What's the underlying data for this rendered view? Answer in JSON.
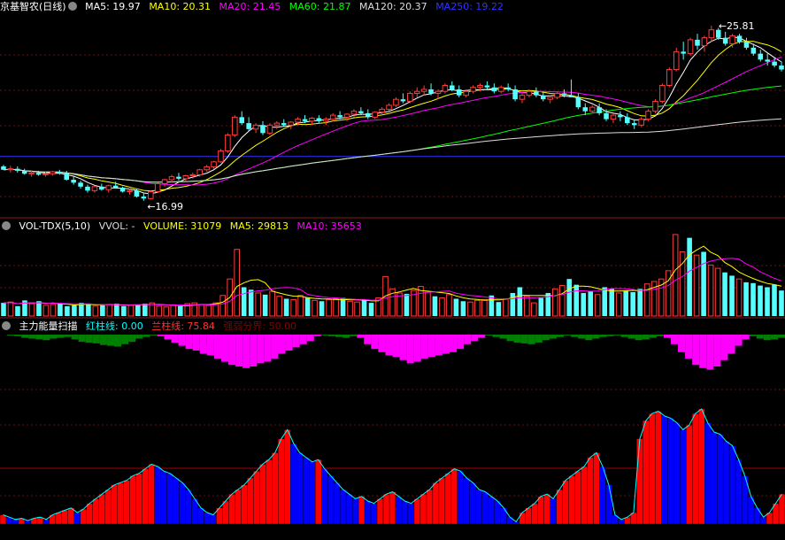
{
  "stock": {
    "name": "京基智农(日线)",
    "ma": [
      {
        "label": "MA5: 19.97",
        "color": "#ffffff"
      },
      {
        "label": "MA10: 20.31",
        "color": "#ffff00"
      },
      {
        "label": "MA20: 21.45",
        "color": "#ff00ff"
      },
      {
        "label": "MA60: 21.87",
        "color": "#00ff00"
      },
      {
        "label": "MA120: 20.37",
        "color": "#dddddd"
      },
      {
        "label": "MA250: 19.22",
        "color": "#3333ff"
      }
    ]
  },
  "volume_panel": {
    "title": "VOL-TDX(5,10)",
    "items": [
      {
        "label": "VVOL: -",
        "color": "#dddddd"
      },
      {
        "label": "VOLUME: 31079",
        "color": "#ffff00"
      },
      {
        "label": "MA5: 29813",
        "color": "#ffff00"
      },
      {
        "label": "MA10: 35653",
        "color": "#ff00ff"
      }
    ]
  },
  "indicator_panel": {
    "title": "主力能量扫描",
    "items": [
      {
        "label": "红柱线: 0.00",
        "color": "#00ffff"
      },
      {
        "label": "兰柱线: 75.84",
        "color": "#ff3333"
      },
      {
        "label": "强弱分界: 50.00",
        "color": "#880000"
      }
    ]
  },
  "chart_data": [
    {
      "type": "candlestick",
      "title": "京基智农(日线)",
      "annotations": [
        {
          "label": "25.81",
          "type": "high"
        },
        {
          "label": "16.99",
          "type": "low"
        }
      ],
      "reference_lines": [
        {
          "name": "MA250",
          "value": 19.22,
          "color": "#3333ff"
        }
      ],
      "ylim": [
        16.4,
        26.3
      ],
      "colors": {
        "up": "#ff3c3c",
        "down": "#54ffff"
      },
      "candles_ohlc": [
        [
          18.72,
          18.8,
          18.55,
          18.55
        ],
        [
          18.55,
          18.75,
          18.42,
          18.6
        ],
        [
          18.6,
          18.72,
          18.4,
          18.5
        ],
        [
          18.5,
          18.6,
          18.3,
          18.35
        ],
        [
          18.35,
          18.5,
          18.2,
          18.4
        ],
        [
          18.4,
          18.5,
          18.25,
          18.3
        ],
        [
          18.3,
          18.45,
          18.2,
          18.35
        ],
        [
          18.35,
          18.5,
          18.25,
          18.45
        ],
        [
          18.45,
          18.55,
          18.3,
          18.4
        ],
        [
          18.4,
          18.5,
          18.0,
          18.05
        ],
        [
          18.05,
          18.2,
          17.8,
          17.9
        ],
        [
          17.9,
          18.0,
          17.6,
          17.7
        ],
        [
          17.7,
          17.8,
          17.4,
          17.5
        ],
        [
          17.5,
          17.75,
          17.4,
          17.7
        ],
        [
          17.7,
          17.85,
          17.5,
          17.55
        ],
        [
          17.55,
          17.8,
          17.4,
          17.75
        ],
        [
          17.75,
          17.95,
          17.6,
          17.65
        ],
        [
          17.65,
          17.7,
          17.4,
          17.45
        ],
        [
          17.45,
          17.6,
          17.3,
          17.5
        ],
        [
          17.5,
          17.6,
          17.15,
          17.2
        ],
        [
          17.2,
          17.35,
          16.99,
          17.1
        ],
        [
          17.1,
          17.5,
          17.05,
          17.45
        ],
        [
          17.45,
          17.9,
          17.4,
          17.85
        ],
        [
          17.85,
          18.1,
          17.7,
          18.05
        ],
        [
          18.05,
          18.3,
          17.9,
          18.2
        ],
        [
          18.2,
          18.4,
          18.0,
          18.1
        ],
        [
          18.1,
          18.3,
          17.95,
          18.25
        ],
        [
          18.25,
          18.4,
          18.1,
          18.3
        ],
        [
          18.3,
          18.6,
          18.2,
          18.55
        ],
        [
          18.55,
          18.8,
          18.45,
          18.7
        ],
        [
          18.7,
          19.0,
          18.6,
          18.95
        ],
        [
          18.95,
          19.6,
          18.9,
          19.5
        ],
        [
          19.5,
          20.4,
          19.4,
          20.3
        ],
        [
          20.3,
          21.3,
          20.2,
          21.2
        ],
        [
          21.2,
          21.5,
          20.8,
          20.9
        ],
        [
          20.9,
          21.2,
          20.5,
          20.6
        ],
        [
          20.6,
          20.9,
          20.4,
          20.8
        ],
        [
          20.8,
          21.0,
          20.3,
          20.4
        ],
        [
          20.4,
          20.9,
          20.3,
          20.8
        ],
        [
          20.8,
          21.0,
          20.6,
          20.9
        ],
        [
          20.9,
          21.1,
          20.7,
          20.8
        ],
        [
          20.8,
          21.0,
          20.6,
          20.95
        ],
        [
          20.95,
          21.2,
          20.8,
          21.1
        ],
        [
          21.1,
          21.3,
          20.9,
          21.0
        ],
        [
          21.0,
          21.2,
          20.8,
          21.15
        ],
        [
          21.15,
          21.3,
          20.9,
          21.0
        ],
        [
          21.0,
          21.2,
          20.8,
          21.1
        ],
        [
          21.1,
          21.4,
          21.0,
          21.3
        ],
        [
          21.3,
          21.5,
          21.1,
          21.2
        ],
        [
          21.2,
          21.4,
          21.0,
          21.35
        ],
        [
          21.35,
          21.6,
          21.2,
          21.5
        ],
        [
          21.5,
          21.7,
          21.3,
          21.4
        ],
        [
          21.4,
          21.6,
          21.1,
          21.2
        ],
        [
          21.2,
          21.5,
          21.1,
          21.45
        ],
        [
          21.45,
          21.7,
          21.3,
          21.6
        ],
        [
          21.6,
          21.9,
          21.5,
          21.8
        ],
        [
          21.8,
          22.2,
          21.7,
          22.1
        ],
        [
          22.1,
          22.4,
          21.9,
          22.0
        ],
        [
          22.0,
          22.5,
          21.9,
          22.4
        ],
        [
          22.4,
          22.7,
          22.2,
          22.5
        ],
        [
          22.5,
          22.8,
          22.3,
          22.6
        ],
        [
          22.6,
          22.9,
          22.3,
          22.4
        ],
        [
          22.4,
          22.6,
          22.1,
          22.5
        ],
        [
          22.5,
          22.9,
          22.4,
          22.8
        ],
        [
          22.8,
          23.0,
          22.5,
          22.6
        ],
        [
          22.6,
          22.8,
          22.2,
          22.3
        ],
        [
          22.3,
          22.6,
          22.2,
          22.5
        ],
        [
          22.5,
          22.8,
          22.4,
          22.7
        ],
        [
          22.7,
          22.9,
          22.5,
          22.8
        ],
        [
          22.8,
          23.0,
          22.6,
          22.7
        ],
        [
          22.7,
          22.9,
          22.4,
          22.5
        ],
        [
          22.5,
          22.8,
          22.4,
          22.7
        ],
        [
          22.7,
          22.9,
          22.5,
          22.6
        ],
        [
          22.6,
          22.8,
          22.0,
          22.1
        ],
        [
          22.1,
          22.4,
          21.9,
          22.3
        ],
        [
          22.3,
          22.6,
          22.2,
          22.5
        ],
        [
          22.5,
          22.7,
          22.2,
          22.3
        ],
        [
          22.3,
          22.5,
          22.0,
          22.1
        ],
        [
          22.1,
          22.3,
          21.9,
          22.2
        ],
        [
          22.2,
          22.5,
          22.1,
          22.4
        ],
        [
          22.4,
          22.6,
          22.2,
          22.3
        ],
        [
          22.3,
          23.1,
          22.2,
          22.2
        ],
        [
          22.2,
          22.4,
          21.6,
          21.7
        ],
        [
          21.7,
          21.9,
          21.3,
          21.5
        ],
        [
          21.5,
          21.8,
          21.4,
          21.7
        ],
        [
          21.7,
          21.9,
          21.3,
          21.4
        ],
        [
          21.4,
          21.6,
          21.0,
          21.1
        ],
        [
          21.1,
          21.4,
          20.9,
          21.3
        ],
        [
          21.3,
          21.5,
          21.0,
          21.2
        ],
        [
          21.2,
          21.4,
          20.8,
          20.9
        ],
        [
          20.9,
          21.1,
          20.6,
          20.8
        ],
        [
          20.8,
          21.2,
          20.7,
          21.1
        ],
        [
          21.1,
          21.6,
          21.0,
          21.5
        ],
        [
          21.5,
          22.1,
          21.4,
          22.0
        ],
        [
          22.0,
          22.9,
          21.9,
          22.8
        ],
        [
          22.8,
          23.7,
          22.7,
          23.6
        ],
        [
          23.6,
          24.7,
          23.5,
          24.5
        ],
        [
          24.5,
          25.0,
          24.1,
          24.4
        ],
        [
          24.4,
          25.2,
          24.3,
          25.1
        ],
        [
          25.1,
          25.4,
          24.6,
          24.8
        ],
        [
          24.8,
          25.3,
          24.5,
          25.2
        ],
        [
          25.2,
          25.81,
          25.0,
          25.6
        ],
        [
          25.6,
          25.7,
          25.1,
          25.2
        ],
        [
          25.2,
          25.5,
          24.8,
          24.9
        ],
        [
          24.9,
          25.4,
          24.7,
          25.3
        ],
        [
          25.3,
          25.4,
          24.9,
          25.0
        ],
        [
          25.0,
          25.2,
          24.6,
          24.7
        ],
        [
          24.7,
          24.9,
          24.3,
          24.4
        ],
        [
          24.4,
          24.6,
          24.0,
          24.1
        ],
        [
          24.1,
          24.4,
          23.8,
          24.0
        ],
        [
          24.0,
          24.2,
          23.7,
          23.8
        ],
        [
          23.8,
          24.0,
          23.5,
          23.6
        ]
      ]
    },
    {
      "type": "bar",
      "title": "VOL-TDX(5,10)",
      "series_name": "VOLUME",
      "ylim": [
        0,
        100000
      ],
      "colors": {
        "up": "#ff3c3c",
        "down": "#54ffff",
        "ma5": "#ffff00",
        "ma10": "#ff00ff"
      },
      "values": [
        16000,
        17000,
        12000,
        19000,
        15000,
        18000,
        13000,
        14000,
        15000,
        12000,
        13000,
        16000,
        15000,
        12000,
        13000,
        14000,
        15000,
        12000,
        13000,
        14000,
        15000,
        16000,
        12000,
        11000,
        13000,
        12000,
        15000,
        16000,
        14000,
        13000,
        16000,
        25000,
        45000,
        81000,
        35000,
        32000,
        28000,
        26000,
        30000,
        24000,
        21000,
        20000,
        25000,
        22000,
        19000,
        18000,
        20000,
        21000,
        22000,
        18000,
        17000,
        19000,
        16000,
        22000,
        48000,
        33000,
        28000,
        27000,
        31000,
        36000,
        29000,
        24000,
        22000,
        26000,
        21000,
        18000,
        17000,
        19000,
        20000,
        25000,
        17000,
        21000,
        28000,
        35000,
        24000,
        16000,
        22000,
        28000,
        33000,
        37000,
        45000,
        38000,
        28000,
        30000,
        26000,
        35000,
        33000,
        28000,
        31000,
        29000,
        33000,
        39000,
        42000,
        45000,
        55000,
        99000,
        78000,
        95000,
        74000,
        78000,
        62000,
        58000,
        53000,
        49000,
        45000,
        41000,
        40000,
        37000,
        35000,
        38000,
        31000
      ],
      "up_flags": [
        0,
        1,
        0,
        0,
        1,
        0,
        1,
        1,
        0,
        0,
        0,
        0,
        0,
        1,
        0,
        1,
        0,
        0,
        1,
        0,
        0,
        1,
        1,
        1,
        1,
        0,
        1,
        1,
        1,
        1,
        1,
        1,
        1,
        1,
        0,
        0,
        1,
        0,
        1,
        1,
        0,
        1,
        1,
        0,
        1,
        0,
        1,
        1,
        0,
        1,
        1,
        0,
        0,
        1,
        1,
        1,
        1,
        0,
        1,
        1,
        1,
        0,
        1,
        1,
        0,
        0,
        1,
        1,
        1,
        0,
        0,
        1,
        0,
        0,
        1,
        1,
        0,
        0,
        1,
        1,
        0,
        0,
        0,
        0,
        1,
        0,
        0,
        1,
        0,
        0,
        0,
        1,
        1,
        1,
        1,
        1,
        1,
        0,
        1,
        0,
        1,
        1,
        0,
        0,
        1,
        0,
        0,
        0,
        0,
        0,
        0
      ]
    },
    {
      "type": "bar",
      "title": "主力能量扫描",
      "series": [
        {
          "name": "红柱线",
          "color": "#ff0000"
        },
        {
          "name": "兰柱线",
          "color": "#0000ff"
        }
      ],
      "top_bars": {
        "colors": {
          "positive": "#ff00ff",
          "negative": "#008000"
        }
      },
      "reference_line": {
        "name": "强弱分界",
        "value": 50
      },
      "ylim": [
        0,
        100
      ],
      "values": [
        8,
        6,
        4,
        5,
        3,
        5,
        6,
        4,
        8,
        10,
        12,
        14,
        10,
        13,
        18,
        22,
        26,
        30,
        34,
        36,
        38,
        42,
        44,
        48,
        52,
        50,
        46,
        44,
        40,
        36,
        30,
        22,
        14,
        10,
        8,
        14,
        20,
        26,
        30,
        34,
        40,
        46,
        52,
        56,
        62,
        74,
        82,
        70,
        62,
        58,
        54,
        56,
        48,
        42,
        36,
        30,
        26,
        22,
        24,
        20,
        18,
        22,
        26,
        28,
        24,
        20,
        18,
        22,
        26,
        30,
        36,
        40,
        44,
        48,
        46,
        40,
        36,
        30,
        28,
        24,
        20,
        14,
        6,
        2,
        10,
        14,
        18,
        24,
        26,
        22,
        30,
        38,
        42,
        46,
        50,
        58,
        62,
        50,
        34,
        8,
        4,
        6,
        10,
        74,
        90,
        96,
        98,
        94,
        92,
        88,
        82,
        86,
        96,
        100,
        88,
        80,
        78,
        72,
        68,
        56,
        42,
        24,
        14,
        6,
        10,
        18,
        26
      ],
      "top_values": [
        0,
        -2,
        -4,
        -8,
        -10,
        -12,
        -14,
        -10,
        -8,
        -6,
        -12,
        -18,
        -20,
        -22,
        -26,
        -28,
        -30,
        -24,
        -18,
        -10,
        -6,
        -2,
        2,
        6,
        10,
        14,
        18,
        20,
        24,
        26,
        30,
        34,
        38,
        40,
        42,
        40,
        36,
        34,
        30,
        24,
        20,
        16,
        12,
        8,
        2,
        -2,
        -4,
        -6,
        -8,
        -4,
        4,
        12,
        18,
        22,
        26,
        28,
        32,
        36,
        34,
        30,
        28,
        26,
        24,
        22,
        18,
        12,
        8,
        4,
        -2,
        -6,
        -10,
        -16,
        -20,
        -22,
        -24,
        -20,
        -14,
        -10,
        -6,
        -2,
        -6,
        -10,
        -14,
        -10,
        -6,
        -4,
        -2,
        -6,
        -10,
        -14,
        -12,
        -8,
        -4,
        4,
        12,
        22,
        30,
        38,
        42,
        44,
        40,
        32,
        24,
        14,
        6,
        -4,
        -10,
        -14,
        -12,
        -8
      ]
    }
  ]
}
